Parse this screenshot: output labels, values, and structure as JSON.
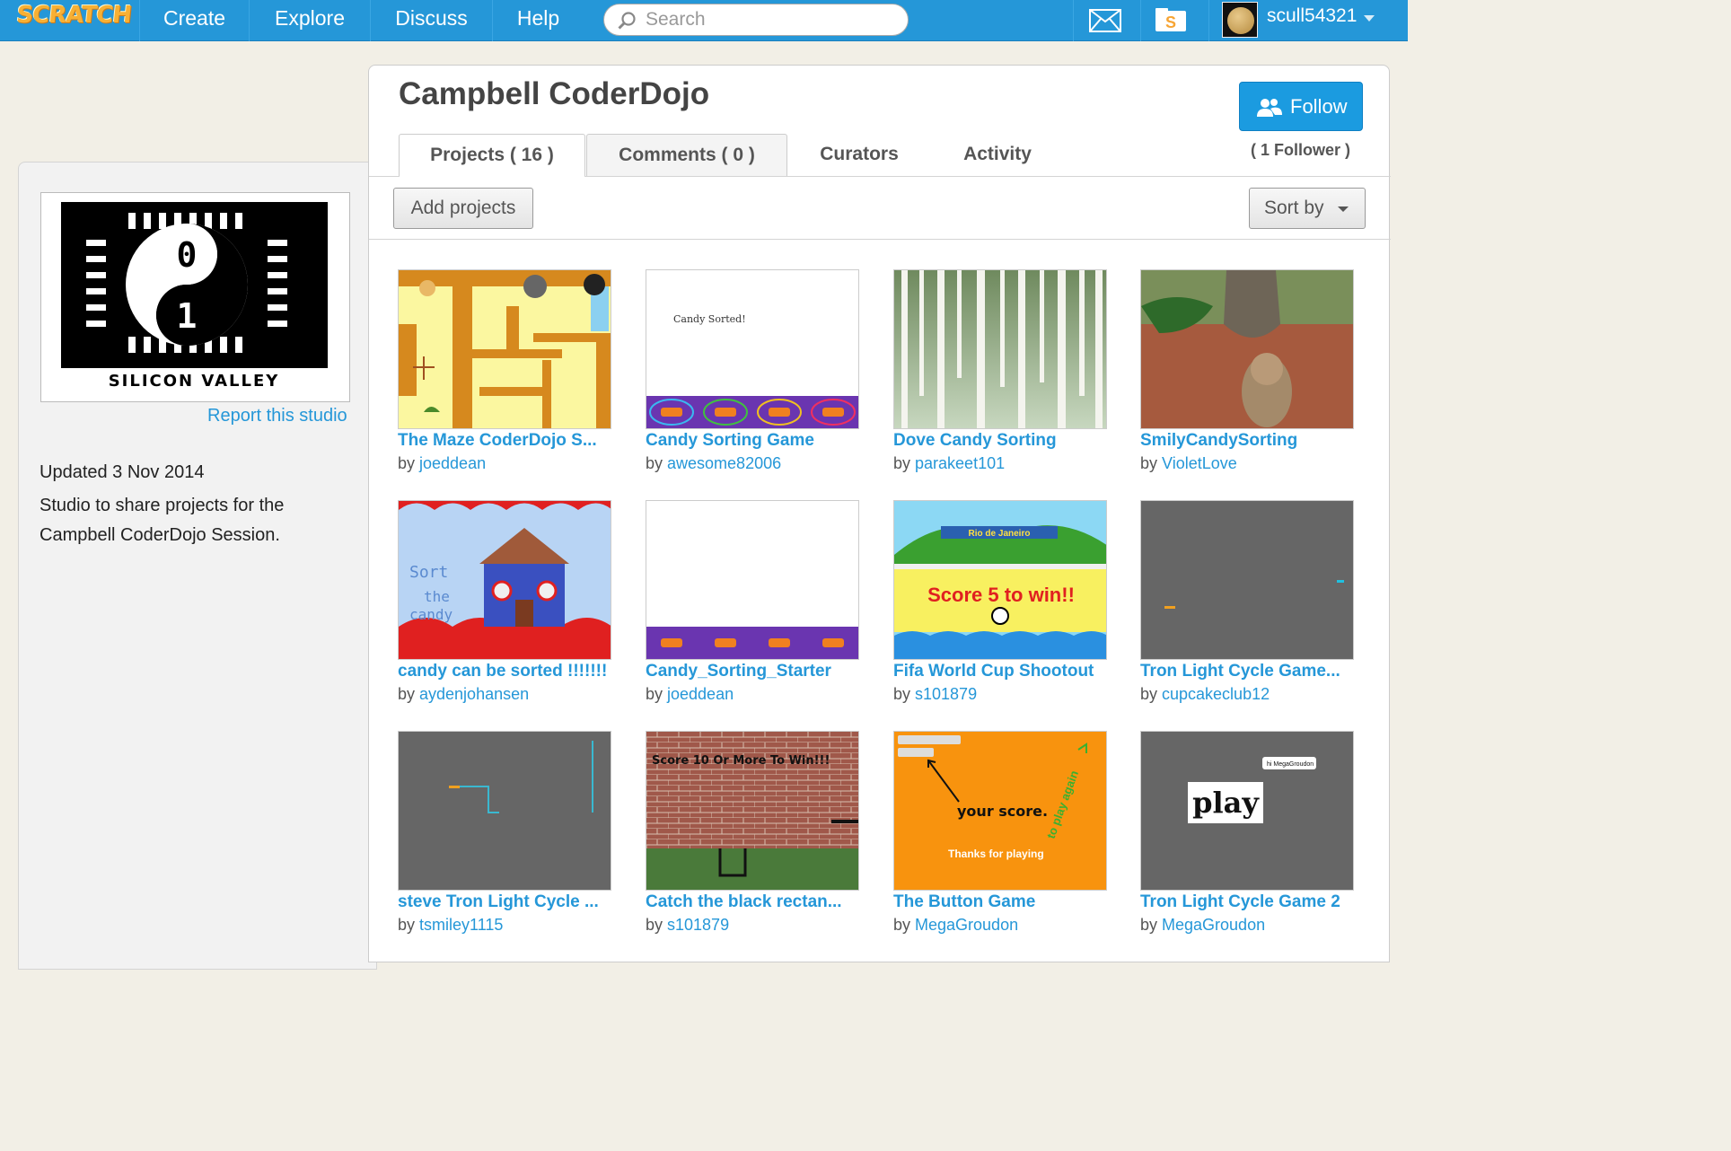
{
  "nav": {
    "logo": "SCRATCH",
    "items": [
      "Create",
      "Explore",
      "Discuss",
      "Help"
    ],
    "search_placeholder": "Search",
    "username": "scull54321"
  },
  "sidebar": {
    "thumb_top_digit": "0",
    "thumb_bottom_digit": "1",
    "thumb_caption": "SILICON VALLEY",
    "report_link": "Report this studio",
    "updated": "Updated 3 Nov 2014",
    "description": "Studio to share projects for the Campbell CoderDojo Session."
  },
  "studio": {
    "title": "Campbell CoderDojo",
    "follow_label": "Follow",
    "followers": "( 1 Follower )",
    "tabs": [
      "Projects ( 16 )",
      "Comments ( 0 )",
      "Curators",
      "Activity"
    ],
    "add_projects_label": "Add projects",
    "sort_label": "Sort by"
  },
  "projects": [
    {
      "title": "The Maze CoderDojo S...",
      "by": "by ",
      "author": "joeddean"
    },
    {
      "title": "Candy Sorting Game",
      "by": "by ",
      "author": "awesome82006"
    },
    {
      "title": "Dove Candy Sorting",
      "by": "by ",
      "author": "parakeet101"
    },
    {
      "title": "SmilyCandySorting",
      "by": "by ",
      "author": "VioletLove"
    },
    {
      "title": "candy can be sorted !!!!!!!",
      "by": "by ",
      "author": "aydenjohansen"
    },
    {
      "title": "Candy_Sorting_Starter",
      "by": "by ",
      "author": "joeddean"
    },
    {
      "title": "Fifa World Cup Shootout",
      "by": "by ",
      "author": "s101879"
    },
    {
      "title": "Tron Light Cycle Game...",
      "by": "by ",
      "author": "cupcakeclub12"
    },
    {
      "title": "steve Tron Light Cycle ...",
      "by": "by ",
      "author": "tsmiley1115"
    },
    {
      "title": "Catch the black rectan...",
      "by": "by ",
      "author": "s101879"
    },
    {
      "title": "The Button Game",
      "by": "by ",
      "author": "MegaGroudon"
    },
    {
      "title": "Tron Light Cycle Game 2",
      "by": "by ",
      "author": "MegaGroudon"
    }
  ],
  "thumb_text": {
    "candy_sorted": "Candy Sorted!",
    "rio": "Rio de Janeiro",
    "score5": "Score 5 to win!!",
    "score10": "Score 10 Or More To Win!!!",
    "your_score": "your score.",
    "thanks": "Thanks for playing",
    "play_again": "to play again",
    "play": "play",
    "megagroudon_bubble": "hi MegaGroudon"
  },
  "colors": {
    "nav_bg": "#2597d8",
    "link": "#2597d8",
    "follow_bg": "#1b9be0",
    "page_bg": "#f2efe6"
  }
}
